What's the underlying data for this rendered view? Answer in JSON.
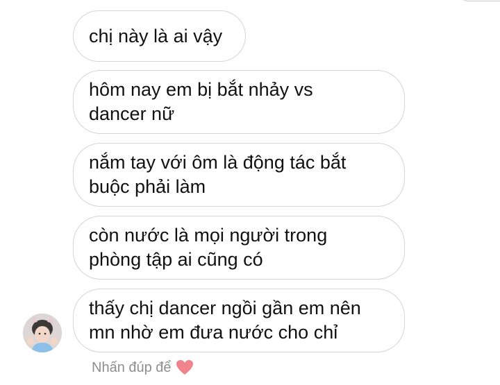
{
  "messages": [
    {
      "lines": [
        "chị này là ai vậy"
      ]
    },
    {
      "lines": [
        "hôm nay em bị bắt nhảy vs",
        "dancer nữ"
      ]
    },
    {
      "lines": [
        "nắm tay với ôm là động tác bắt",
        "buộc phải làm"
      ]
    },
    {
      "lines": [
        "còn nước là mọi người trong",
        "phòng tập ai cũng có"
      ]
    },
    {
      "lines": [
        "thấy chị dancer ngồi gần em nên",
        "mn nhờ em đưa nước cho chỉ"
      ]
    }
  ],
  "react_hint": {
    "text": "Nhấn đúp để",
    "icon": "heart-icon",
    "heart_color": "#f0848c"
  },
  "sender": {
    "avatar_icon": "avatar"
  },
  "colors": {
    "bubble_border": "#d4d4d4",
    "text": "#111111",
    "hint_text": "#8e8e8e"
  }
}
